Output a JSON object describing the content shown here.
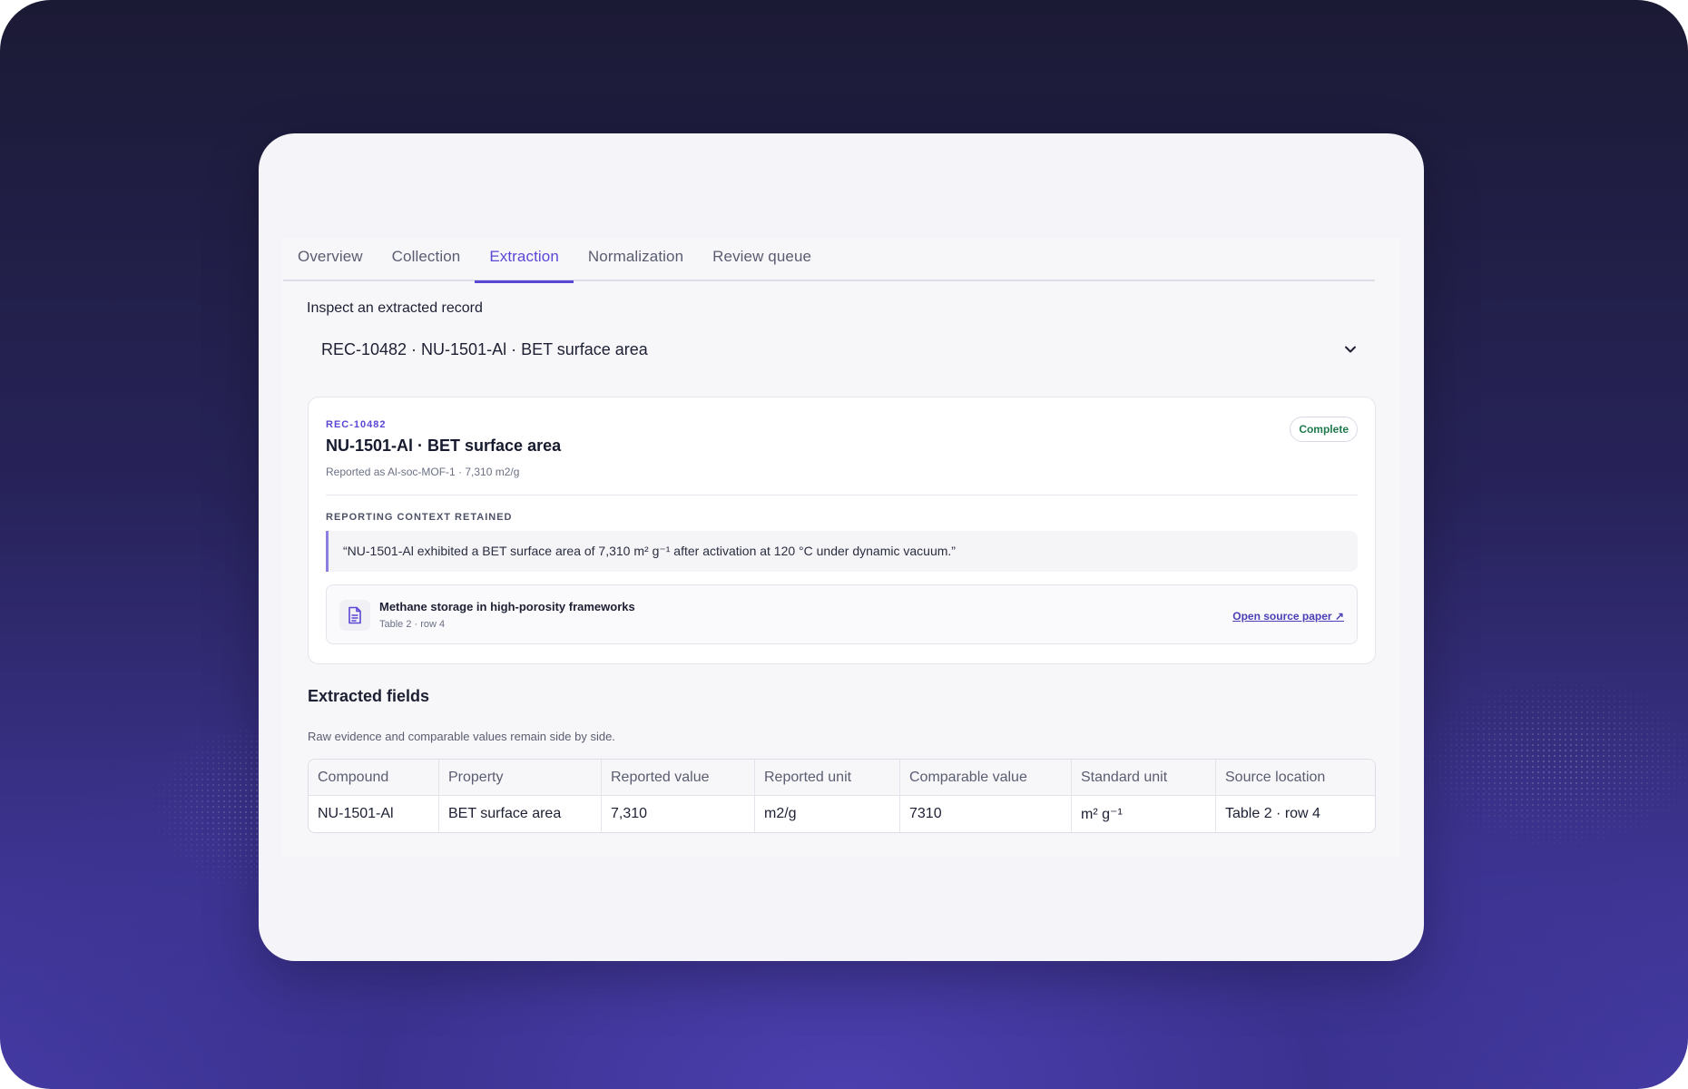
{
  "tabs": [
    {
      "label": "Overview",
      "active": false
    },
    {
      "label": "Collection",
      "active": false
    },
    {
      "label": "Extraction",
      "active": true
    },
    {
      "label": "Normalization",
      "active": false
    },
    {
      "label": "Review queue",
      "active": false
    }
  ],
  "record_select": {
    "label": "Inspect an extracted record",
    "value": "REC-10482 · NU-1501-Al · BET surface area"
  },
  "record": {
    "id": "REC-10482",
    "title": "NU-1501-Al · BET surface area",
    "reported_as": "Reported as Al-soc-MOF-1 · 7,310 m2/g",
    "status": "Complete",
    "context_label": "REPORTING CONTEXT RETAINED",
    "quote": "“NU-1501-Al exhibited a BET surface area of 7,310 m² g⁻¹ after activation at 120 °C under dynamic vacuum.”",
    "source": {
      "title": "Methane storage in high-porosity frameworks",
      "location": "Table 2 · row 4",
      "link_label": "Open source paper ↗"
    }
  },
  "fields": {
    "title": "Extracted fields",
    "subtitle": "Raw evidence and comparable values remain side by side.",
    "columns": [
      "Compound",
      "Property",
      "Reported value",
      "Reported unit",
      "Comparable value",
      "Standard unit",
      "Source location"
    ],
    "rows": [
      [
        "NU-1501-Al",
        "BET surface area",
        "7,310",
        "m2/g",
        "7310",
        "m² g⁻¹",
        "Table 2 · row 4"
      ]
    ]
  },
  "colors": {
    "accent": "#5b47d6",
    "status_complete": "#1f7a4c"
  },
  "icons": {
    "select_chevron": "chevron-down-icon",
    "source_doc": "document-icon"
  }
}
